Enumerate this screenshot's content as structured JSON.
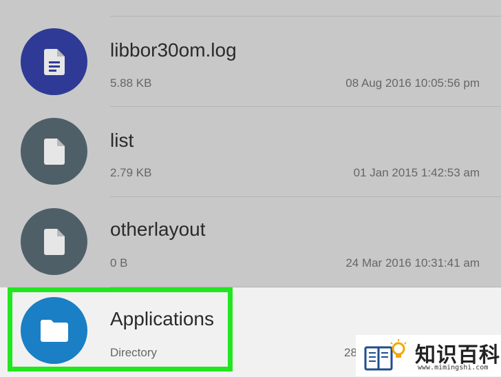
{
  "files": [
    {
      "name": "libbor30om.log",
      "size": "5.88 KB",
      "date": "08 Aug 2016 10:05:56 pm",
      "icon": "document-icon",
      "color": "#2f3a96"
    },
    {
      "name": "list",
      "size": "2.79 KB",
      "date": "01 Jan 2015 1:42:53 am",
      "icon": "file-icon",
      "color": "#4f5f68"
    },
    {
      "name": "otherlayout",
      "size": "0 B",
      "date": "24 Mar 2016 10:31:41 am",
      "icon": "file-icon",
      "color": "#4f5f68"
    },
    {
      "name": "Applications",
      "size": "Directory",
      "date": "28",
      "icon": "folder-icon",
      "color": "#1a7fc4",
      "highlighted": true
    }
  ],
  "watermark": {
    "text": "知识百科",
    "url": "www.mimingshi.com",
    "logo": "book-lightbulb-icon"
  },
  "colors": {
    "highlight_border": "#22e61f",
    "background": "#c8c8c8"
  }
}
